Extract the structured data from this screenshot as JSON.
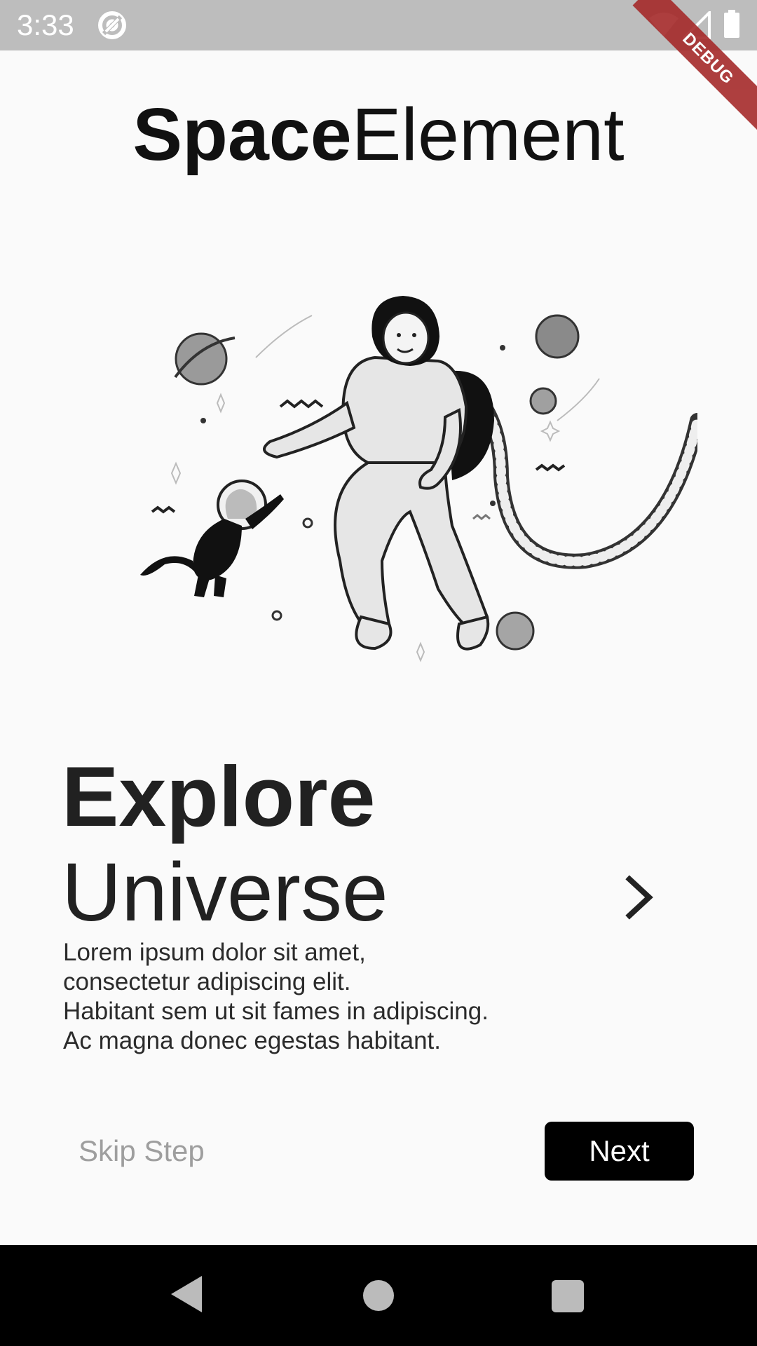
{
  "status_bar": {
    "time": "3:33",
    "icons": [
      "at-sign-icon",
      "wifi-icon",
      "signal-icon",
      "battery-icon"
    ]
  },
  "debug_banner": "DEBUG",
  "app_title": {
    "bold": "Space",
    "light": "Element"
  },
  "onboarding": {
    "headline_bold": "Explore",
    "headline_light": "Universe",
    "description_lines": [
      "Lorem ipsum dolor sit amet,",
      "consectetur adipiscing elit.",
      "Habitant sem ut sit fames in adipiscing.",
      "Ac magna donec egestas habitant."
    ]
  },
  "actions": {
    "skip_label": "Skip Step",
    "next_label": "Next"
  },
  "nav_bar": {
    "icons": [
      "back-icon",
      "home-icon",
      "recents-icon"
    ]
  },
  "colors": {
    "button_bg": "#000000",
    "skip_text": "#9e9e9e",
    "background": "#fafafa",
    "status_bar": "#bdbdbd",
    "debug_banner": "#a52a2a"
  }
}
